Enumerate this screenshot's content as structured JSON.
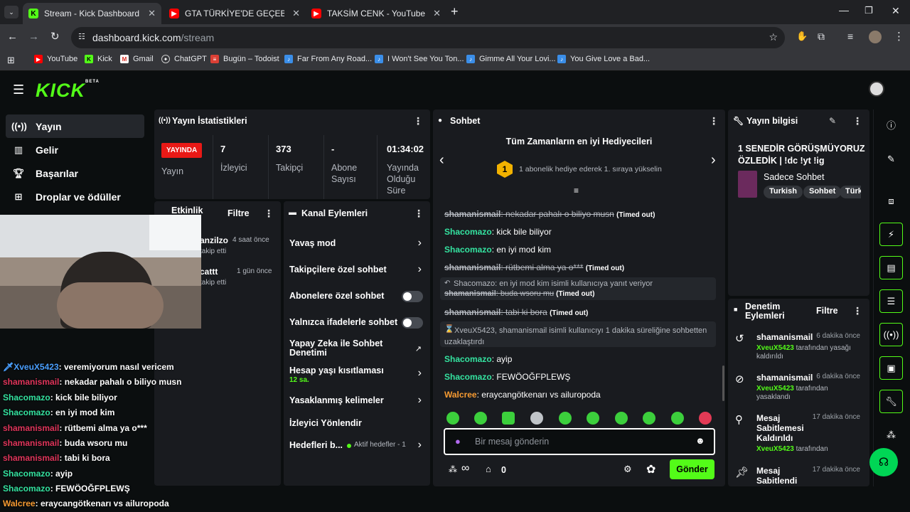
{
  "browser": {
    "tabs": [
      {
        "title": "Stream - Kick Dashboard",
        "active": true
      },
      {
        "title": "GTA TÜRKİYE'DE GEÇEBİLİRMİŞ"
      },
      {
        "title": "TAKSİM CENK - YouTube"
      }
    ],
    "url_host": "dashboard.kick.com",
    "url_path": "/stream",
    "bookmarks": [
      "YouTube",
      "Kick",
      "Gmail",
      "ChatGPT",
      "Bugün – Todoist",
      "Far From Any Road...",
      "I Won't See You Ton...",
      "Gimme All Your Lovi...",
      "You Give Love a Bad..."
    ]
  },
  "app": {
    "logo_text": "KICK",
    "logo_badge": "BETA",
    "sidebar": [
      {
        "label": "Yayın",
        "icon": "broadcast-icon",
        "active": true
      },
      {
        "label": "Gelir",
        "icon": "revenue-icon"
      },
      {
        "label": "Başarılar",
        "icon": "trophy-icon"
      },
      {
        "label": "Droplar ve ödüller",
        "icon": "gift-icon"
      }
    ]
  },
  "stats": {
    "title": "Yayın İstatistikleri",
    "live_badge": "YAYINDA",
    "live_label": "Yayın",
    "items": [
      {
        "value": "7",
        "label": "İzleyici"
      },
      {
        "value": "373",
        "label": "Takipçi"
      },
      {
        "value": "-",
        "label": "Abone Sayısı"
      },
      {
        "value": "01:34:02",
        "label": "Yayında Olduğu Süre"
      }
    ]
  },
  "activity": {
    "title": "Etkinlik",
    "filter": "Filtre",
    "items": [
      {
        "name": "anzilzo",
        "time": "4 saat önce",
        "action": "takip etti"
      },
      {
        "name": "cattt",
        "time": "1 gün önce",
        "action": "takip etti"
      }
    ]
  },
  "channel_actions": {
    "title": "Kanal Eylemleri",
    "rows": [
      {
        "label": "Yavaş mod",
        "kind": "chevron"
      },
      {
        "label": "Takipçilere özel sohbet",
        "kind": "chevron"
      },
      {
        "label": "Abonelere özel sohbet",
        "kind": "toggle"
      },
      {
        "label": "Yalnızca ifadelerle sohbet",
        "kind": "toggle"
      },
      {
        "label": "Yapay Zeka ile Sohbet Denetimi",
        "kind": "external"
      },
      {
        "label": "Hesap yaşı kısıtlaması",
        "sub": "12 sa.",
        "kind": "chevron"
      },
      {
        "label": "Yasaklanmış kelimeler",
        "kind": "chevron"
      },
      {
        "label": "İzleyici Yönlendir",
        "kind": "none"
      },
      {
        "label": "Hedefleri b...",
        "sub": "Aktif hedefler - 1",
        "kind": "chevron"
      }
    ]
  },
  "chat": {
    "title": "Sohbet",
    "gifters_title": "Tüm Zamanların en iyi Hediyecileri",
    "gifters_rank": "1",
    "gifters_hint": "1 abonelik hediye ederek 1. sıraya yükselin",
    "messages": [
      {
        "user": "shamanismail",
        "text": "nekadar pahalı o biliyo musn",
        "timeout": "(Timed out)",
        "color": "red",
        "struck": true
      },
      {
        "user": "Shacomazo",
        "text": "kick bile biliyor",
        "color": "green"
      },
      {
        "user": "Shacomazo",
        "text": "en iyi mod kim",
        "color": "green"
      },
      {
        "user": "shamanismail",
        "text": "rütbemi alma ya o***",
        "timeout": "(Timed out)",
        "color": "red",
        "struck": true
      },
      {
        "reply_to": "Shacomazo: en iyi mod kim isimli kullanıcıya yanıt veriyor",
        "user": "shamanismail",
        "text": "buda wsoru mu",
        "timeout": "(Timed out)",
        "color": "red",
        "struck": true
      },
      {
        "user": "shamanismail",
        "text": "tabi ki bora",
        "timeout": "(Timed out)",
        "color": "red",
        "struck": true
      },
      {
        "system": "XveuX5423, shamanismail isimli kullanıcıyı 1 dakika süreliğine sohbetten uzaklaştırdı"
      },
      {
        "user": "Shacomazo",
        "text": "ayip",
        "color": "green"
      },
      {
        "user": "Shacomazo",
        "text": "FEWÖOĞFPLEWŞ",
        "color": "green"
      },
      {
        "user": "Walcree",
        "text": "eraycangötkenarı vs ailuropoda",
        "color": "orange"
      }
    ],
    "input_placeholder": "Bir mesaj gönderin",
    "points": "∞",
    "store_count": "0",
    "send": "Gönder"
  },
  "stream_info": {
    "title": "Yayın bilgisi",
    "stream_title": "1 SENEDİR GÖRÜŞMÜYORUZ ÖZLEDİK | !dc !yt !ig",
    "category": "Sadece Sohbet",
    "tags": [
      "Turkish",
      "Sohbet",
      "Türk"
    ]
  },
  "mod_log": {
    "title": "Denetim Eylemleri",
    "filter": "Filtre",
    "items": [
      {
        "icon": "undo-icon",
        "name": "shamanismail",
        "time": "6 dakika önce",
        "by": "XveuX5423",
        "detail": "tarafından yasağı kaldırıldı"
      },
      {
        "icon": "ban-icon",
        "name": "shamanismail",
        "time": "6 dakika önce",
        "by": "XveuX5423",
        "detail": "tarafından yasaklandı"
      },
      {
        "icon": "unpin-icon",
        "name": "Mesaj Sabitlemesi Kaldırıldı",
        "time": "17 dakika önce",
        "by": "XveuX5423",
        "detail": "tarafından"
      },
      {
        "icon": "pin-icon",
        "name": "Mesaj Sabitlendi",
        "time": "17 dakika önce"
      }
    ]
  },
  "overlay_chat": [
    {
      "user": "XveuX5423",
      "text": "veremiyorum nasıl vericem",
      "color": "blue"
    },
    {
      "user": "shamanismail",
      "text": "nekadar pahalı o biliyo musn",
      "color": "red"
    },
    {
      "user": "Shacomazo",
      "text": "kick bile biliyor",
      "color": "green"
    },
    {
      "user": "Shacomazo",
      "text": "en iyi mod kim",
      "color": "green"
    },
    {
      "user": "shamanismail",
      "text": "rütbemi alma ya o***",
      "color": "red"
    },
    {
      "user": "shamanismail",
      "text": "buda wsoru mu",
      "color": "red"
    },
    {
      "user": "shamanismail",
      "text": "tabi ki bora",
      "color": "red"
    },
    {
      "user": "Shacomazo",
      "text": "ayip",
      "color": "green"
    },
    {
      "user": "Shacomazo",
      "text": "FEWÖOĞFPLEWŞ",
      "color": "green"
    },
    {
      "user": "Walcree",
      "text": "eraycangötkenarı vs ailuropoda",
      "color": "orange"
    }
  ],
  "colors": {
    "brand": "#53fc18",
    "live": "#e91916",
    "panel": "#191b1f"
  }
}
